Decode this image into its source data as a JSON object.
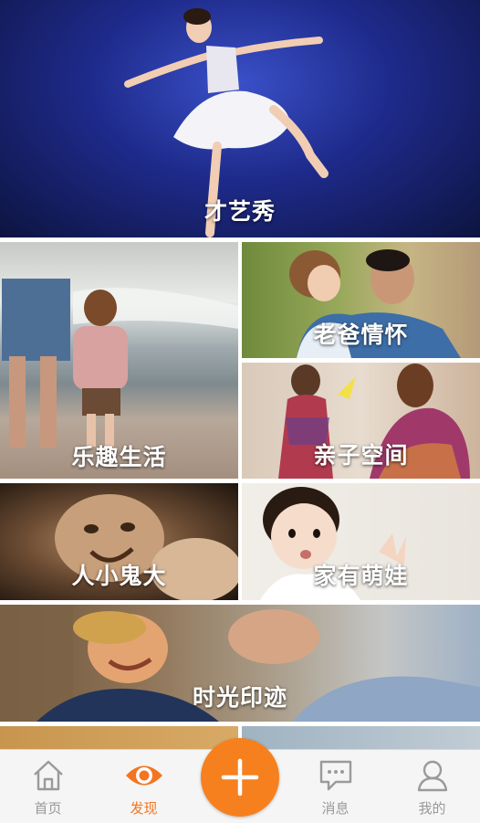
{
  "tiles": [
    {
      "label": "才艺秀"
    },
    {
      "label": "乐趣生活"
    },
    {
      "label": "老爸情怀"
    },
    {
      "label": "亲子空间"
    },
    {
      "label": "人小鬼大"
    },
    {
      "label": "家有萌娃"
    },
    {
      "label": "时光印迹"
    }
  ],
  "tabbar": {
    "home": "首页",
    "discover": "发现",
    "messages": "消息",
    "mine": "我的"
  },
  "colors": {
    "accent": "#f37521",
    "plus_button": "#f7801e",
    "tab_inactive": "#999999"
  }
}
